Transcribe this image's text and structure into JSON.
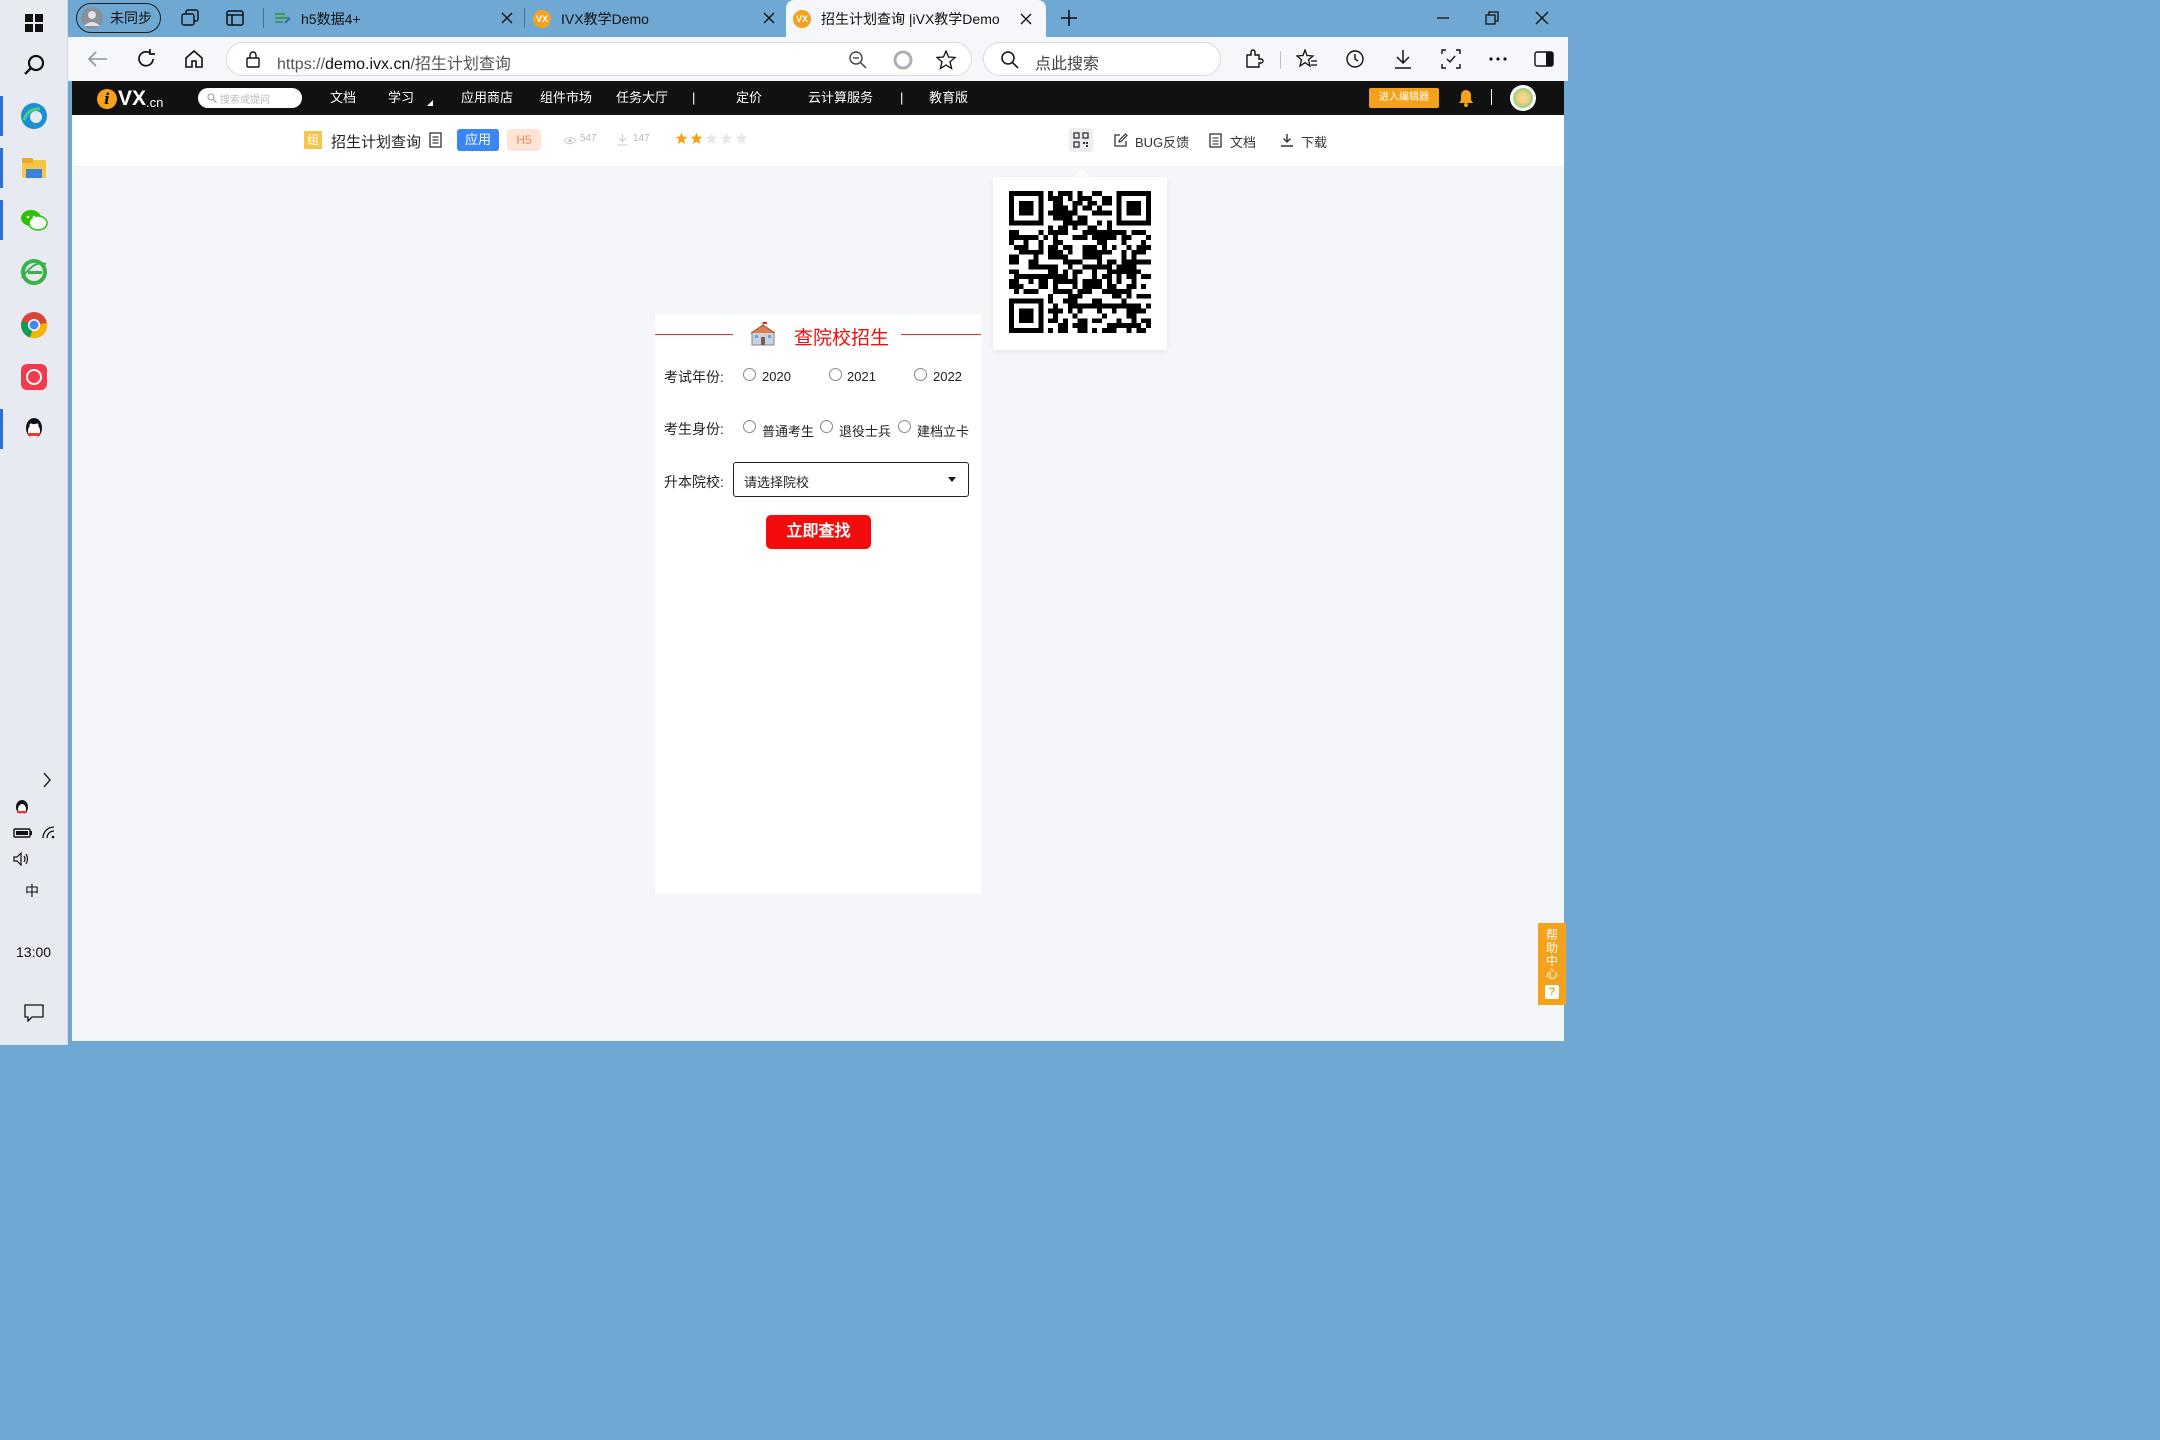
{
  "taskbar": {
    "time": "13:00",
    "ime": "中",
    "items": [
      {
        "name": "windows-start-icon"
      },
      {
        "name": "search-icon"
      },
      {
        "name": "edge-icon"
      },
      {
        "name": "file-explorer-icon"
      },
      {
        "name": "wechat-icon"
      },
      {
        "name": "ie-icon"
      },
      {
        "name": "chrome-icon"
      },
      {
        "name": "app-red-icon"
      },
      {
        "name": "qq-icon"
      }
    ]
  },
  "browser": {
    "profile": "未同步",
    "tabs": [
      {
        "label": "h5数据4+",
        "favicon": "h5"
      },
      {
        "label": "IVX教学Demo",
        "favicon": "VX"
      },
      {
        "label": "招生计划查询 |iVX教学Demo",
        "favicon": "VX"
      }
    ],
    "url": "https://demo.ivx.cn/招生计划查询",
    "url_prefix": "https://",
    "url_host": "demo.ivx.cn",
    "url_path": "/招生计划查询",
    "search_placeholder": "点此搜索"
  },
  "site": {
    "logo_main": "VX",
    "logo_suffix": ".cn",
    "search_placeholder": "搜索或提问",
    "nav": [
      "文档",
      "学习",
      "应用商店",
      "组件市场",
      "任务大厅",
      "|",
      "定价",
      "云计算服务",
      "|",
      "教育版"
    ],
    "enter_editor": "进入编辑器",
    "badge": "组",
    "app_title": "招生计划查询",
    "tag_app": "应用",
    "tag_h5": "H5",
    "views": "547",
    "downloads": "147",
    "rating": 2,
    "rating_max": 5,
    "bug_feedback": "BUG反馈",
    "docs": "文档",
    "download": "下载",
    "help_center": [
      "帮",
      "助",
      "中",
      "心"
    ],
    "help_q": "?"
  },
  "form": {
    "title": "查院校招生",
    "year_label": "考试年份:",
    "years": [
      "2020",
      "2021",
      "2022"
    ],
    "identity_label": "考生身份:",
    "identities": [
      "普通考生",
      "退役士兵",
      "建档立卡"
    ],
    "school_label": "升本院校:",
    "school_placeholder": "请选择院校",
    "submit": "立即查找"
  },
  "colors": {
    "accent_red": "#f40c0c",
    "brand_orange": "#f4a21b",
    "tag_blue": "#3a86f3"
  }
}
